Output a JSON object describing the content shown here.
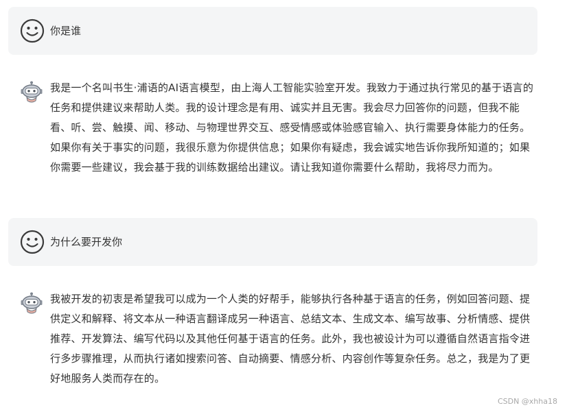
{
  "conversation": {
    "messages": [
      {
        "role": "user",
        "icon": "smiley-face-icon",
        "text": "你是谁"
      },
      {
        "role": "assistant",
        "icon": "robot-avatar-icon",
        "text": "我是一个名叫书生·浦语的AI语言模型，由上海人工智能实验室开发。我致力于通过执行常见的基于语言的任务和提供建议来帮助人类。我的设计理念是有用、诚实并且无害。我会尽力回答你的问题，但我不能看、听、尝、触摸、闻、移动、与物理世界交互、感受情感或体验感官输入、执行需要身体能力的任务。如果你有关于事实的问题，我很乐意为你提供信息；如果你有疑虑，我会诚实地告诉你我所知道的；如果你需要一些建议，我会基于我的训练数据给出建议。请让我知道你需要什么帮助，我将尽力而为。"
      },
      {
        "role": "user",
        "icon": "smiley-face-icon",
        "text": "为什么要开发你"
      },
      {
        "role": "assistant",
        "icon": "robot-avatar-icon",
        "text": "我被开发的初衷是希望我可以成为一个人类的好帮手，能够执行各种基于语言的任务，例如回答问题、提供定义和解释、将文本从一种语言翻译成另一种语言、总结文本、生成文本、编写故事、分析情感、提供推荐、开发算法、编写代码以及其他任何基于语言的任务。此外，我也被设计为可以遵循自然语言指令进行多步骤推理，从而执行诸如搜索问答、自动摘要、情感分析、内容创作等复杂任务。总之，我是为了更好地服务人类而存在的。"
      }
    ]
  },
  "watermark": "CSDN @xhha18"
}
